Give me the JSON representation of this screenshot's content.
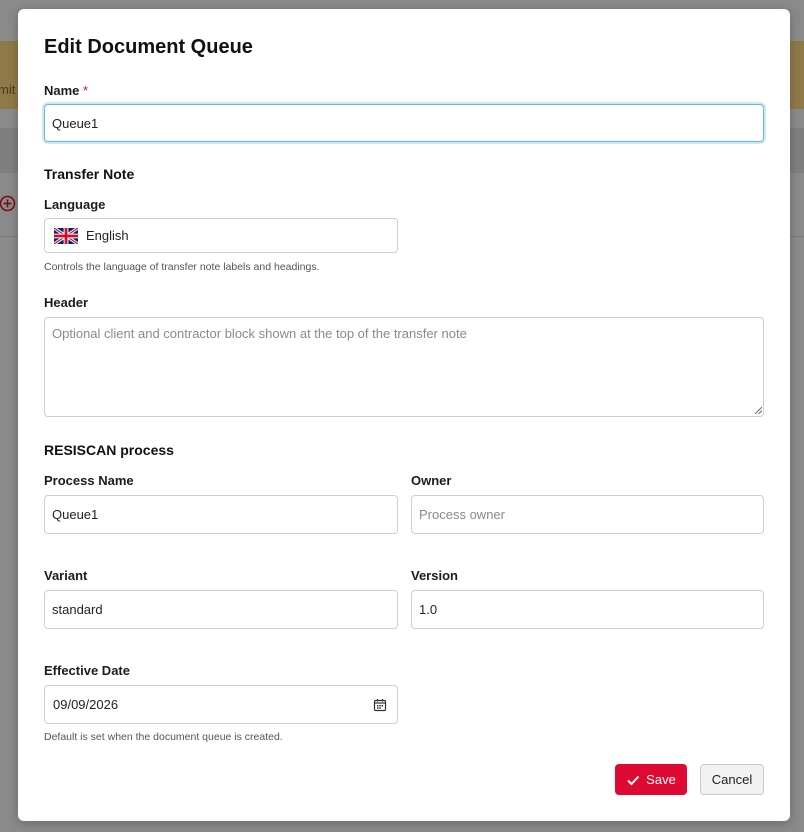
{
  "background": {
    "banner_text": "mit"
  },
  "modal": {
    "title": "Edit Document Queue",
    "name": {
      "label": "Name",
      "required_mark": "*",
      "value": "Queue1"
    },
    "transfer_note": {
      "section_title": "Transfer Note",
      "language": {
        "label": "Language",
        "value": "English",
        "flag_icon": "uk-flag-icon",
        "help": "Controls the language of transfer note labels and headings."
      },
      "header": {
        "label": "Header",
        "placeholder": "Optional client and contractor block shown at the top of the transfer note",
        "value": ""
      }
    },
    "process": {
      "section_title": "RESISCAN process",
      "process_name": {
        "label": "Process Name",
        "value": "Queue1"
      },
      "owner": {
        "label": "Owner",
        "placeholder": "Process owner",
        "value": ""
      },
      "variant": {
        "label": "Variant",
        "value": "standard"
      },
      "version": {
        "label": "Version",
        "value": "1.0"
      },
      "effective_date": {
        "label": "Effective Date",
        "value": "09/09/2026",
        "help": "Default is set when the document queue is created."
      }
    },
    "actions": {
      "save_label": "Save",
      "cancel_label": "Cancel"
    }
  },
  "colors": {
    "accent_red": "#df0a33",
    "focus_border": "#6bb8d6",
    "required": "#d0112b"
  }
}
